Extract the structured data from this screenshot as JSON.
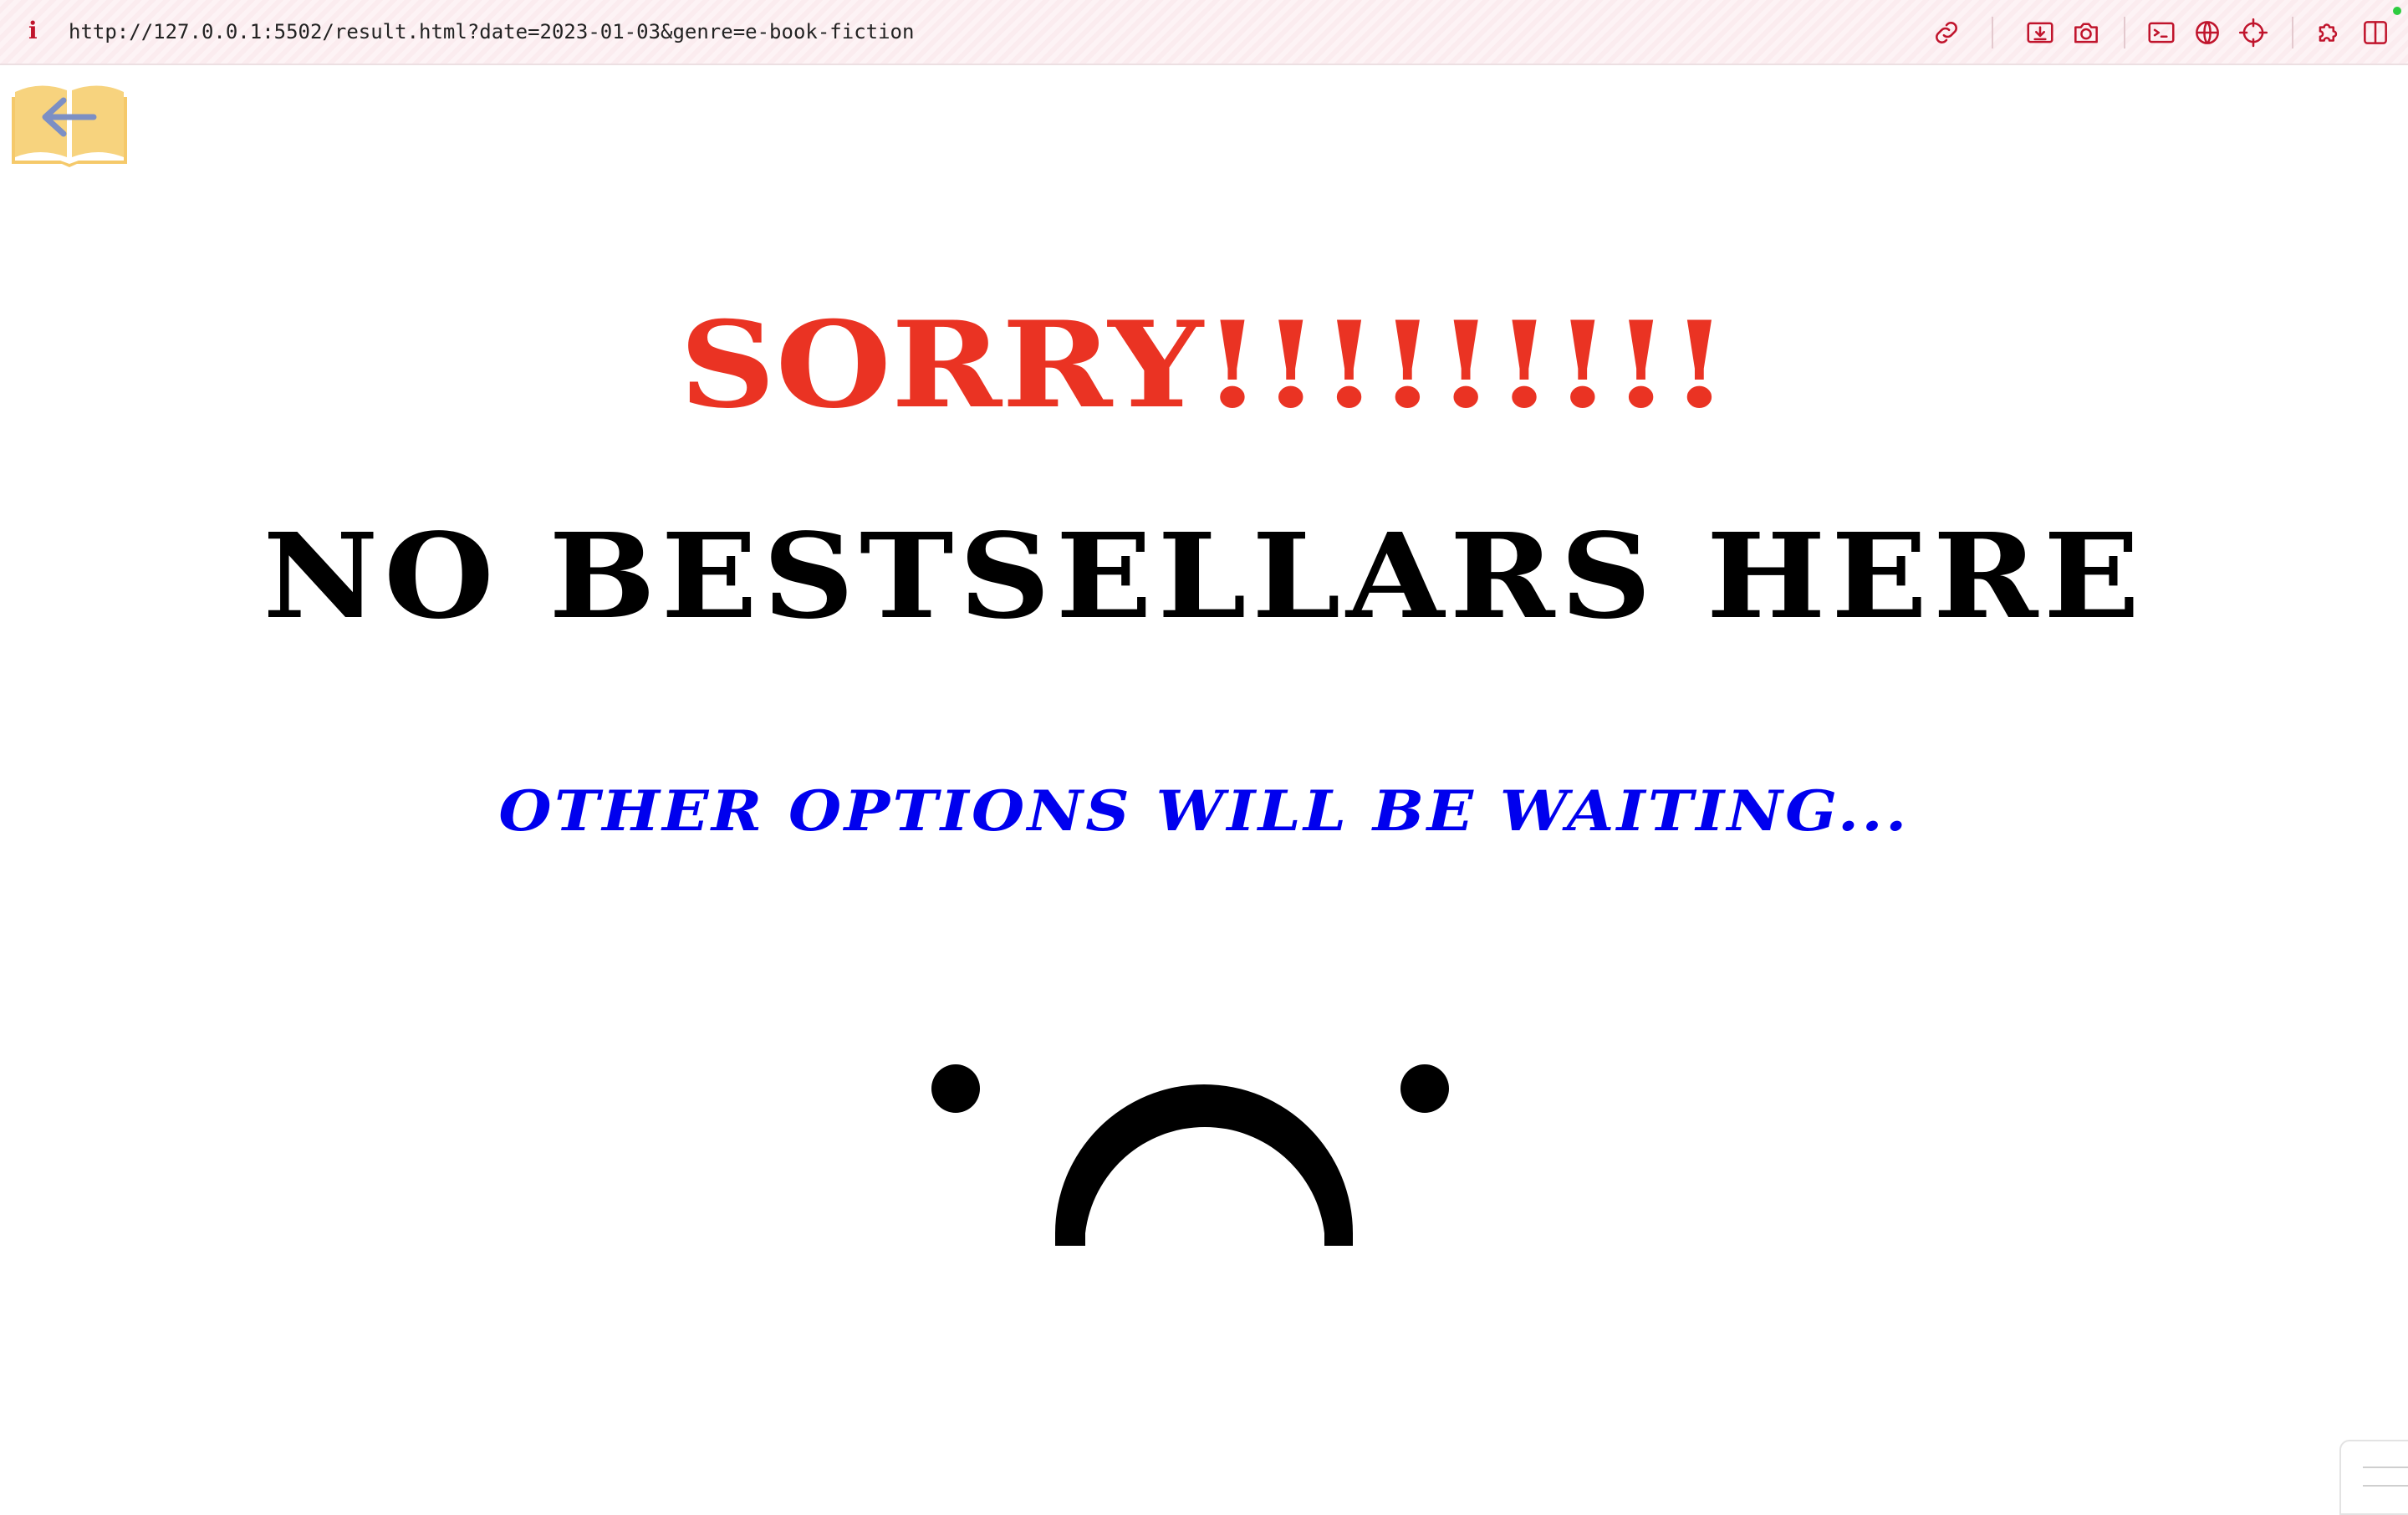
{
  "browser": {
    "url": "http://127.0.0.1:5502/result.html?date=2023-01-03&genre=e-book-fiction",
    "info_icon": "i",
    "icons": [
      "link-icon",
      "download-icon",
      "camera-icon",
      "terminal-icon",
      "globe-icon",
      "crosshair-icon",
      "extension-icon",
      "split-view-icon"
    ],
    "accent_color": "#c0142c"
  },
  "page": {
    "back_button_icon": "book-back-arrow-icon",
    "sorry_text": "SORRY!!!!!!!!!",
    "main_text": "NO BESTSELLARS HERE",
    "sub_text": "OTHER OPTIONS WILL BE WAITING...",
    "sorry_color": "#ea3323",
    "main_color": "#000000",
    "sub_color": "#0000ee"
  }
}
